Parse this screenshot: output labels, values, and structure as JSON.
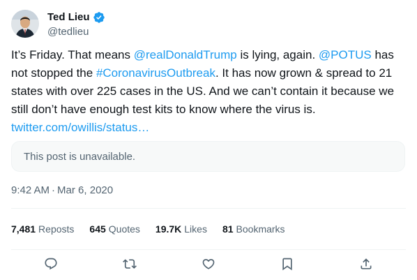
{
  "author": {
    "display_name": "Ted Lieu",
    "handle": "@tedlieu",
    "verified_icon": "verified-badge-icon"
  },
  "post": {
    "segments": [
      {
        "text": "It’s Friday. That means ",
        "link": false
      },
      {
        "text": "@realDonaldTrump",
        "link": true
      },
      {
        "text": " is lying, again. ",
        "link": false
      },
      {
        "text": "@POTUS",
        "link": true
      },
      {
        "text": " has not stopped the ",
        "link": false
      },
      {
        "text": "#CoronavirusOutbreak",
        "link": true
      },
      {
        "text": ". It has now grown & spread to 21 states with over 225 cases in the US. And we can’t contain it because we still don’t have enough test kits to know where the virus is. ",
        "link": false
      },
      {
        "text": "twitter.com/owillis/status…",
        "link": true
      }
    ]
  },
  "quoted": {
    "unavailable_text": "This post is unavailable."
  },
  "meta": {
    "time": "9:42 AM",
    "separator": "·",
    "date": "Mar 6, 2020"
  },
  "stats": {
    "reposts_count": "7,481",
    "reposts_label": "Reposts",
    "quotes_count": "645",
    "quotes_label": "Quotes",
    "likes_count": "19.7K",
    "likes_label": "Likes",
    "bookmarks_count": "81",
    "bookmarks_label": "Bookmarks"
  },
  "actions": [
    {
      "name": "reply-icon"
    },
    {
      "name": "repost-icon"
    },
    {
      "name": "like-icon"
    },
    {
      "name": "bookmark-icon"
    },
    {
      "name": "share-icon"
    }
  ],
  "colors": {
    "link": "#1d9bf0",
    "text": "#0f1419",
    "secondary": "#536471",
    "verified": "#1d9bf0"
  }
}
